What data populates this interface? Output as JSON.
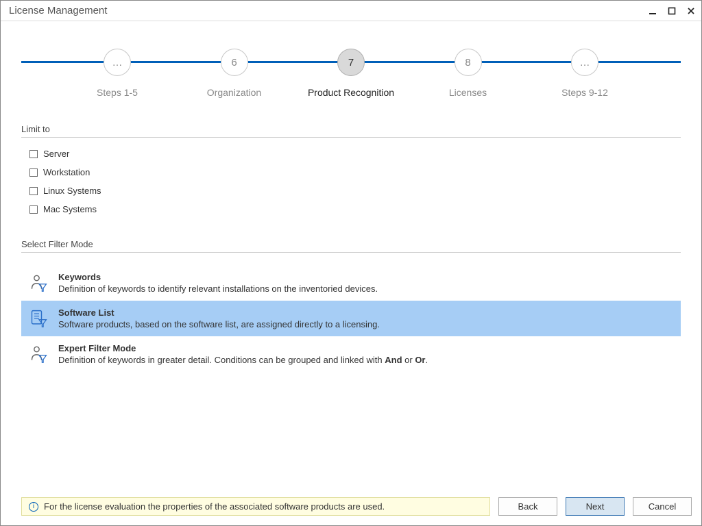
{
  "window": {
    "title": "License Management"
  },
  "stepper": {
    "steps": [
      {
        "num": "…",
        "label": "Steps 1-5",
        "active": false
      },
      {
        "num": "6",
        "label": "Organization",
        "active": false
      },
      {
        "num": "7",
        "label": "Product Recognition",
        "active": true
      },
      {
        "num": "8",
        "label": "Licenses",
        "active": false
      },
      {
        "num": "…",
        "label": "Steps 9-12",
        "active": false
      }
    ]
  },
  "limit": {
    "header": "Limit to",
    "options": [
      {
        "label": "Server",
        "checked": false
      },
      {
        "label": "Workstation",
        "checked": false
      },
      {
        "label": "Linux Systems",
        "checked": false
      },
      {
        "label": "Mac Systems",
        "checked": false
      }
    ]
  },
  "filter": {
    "header": "Select Filter Mode",
    "options": [
      {
        "key": "keywords",
        "title": "Keywords",
        "desc": "Definition of keywords to identify relevant installations on the inventoried devices.",
        "selected": false
      },
      {
        "key": "software-list",
        "title": "Software List",
        "desc": "Software products, based on the software list, are assigned directly to a licensing.",
        "selected": true
      },
      {
        "key": "expert",
        "title": "Expert Filter Mode",
        "desc_pre": "Definition of keywords in greater detail. Conditions can be grouped and linked with ",
        "desc_and": "And",
        "desc_or_join": " or ",
        "desc_or": "Or",
        "desc_post": ".",
        "selected": false
      }
    ]
  },
  "footer": {
    "info": "For the license evaluation the properties of the associated software products are used.",
    "buttons": {
      "back": "Back",
      "next": "Next",
      "cancel": "Cancel"
    }
  }
}
